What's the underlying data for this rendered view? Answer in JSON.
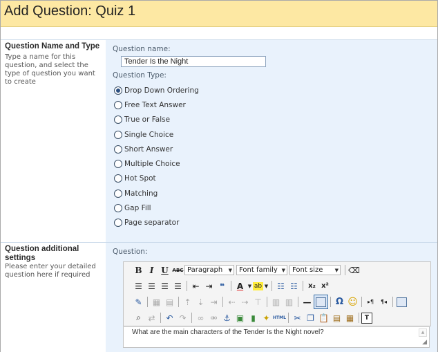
{
  "page": {
    "title": "Add Question: Quiz 1"
  },
  "section_name_type": {
    "title": "Question Name and Type",
    "description": "Type a name for this question, and select the type of question you want to create",
    "name_label": "Question name:",
    "name_value": "Tender Is the Night",
    "type_label": "Question Type:",
    "types": [
      {
        "label": "Drop Down Ordering",
        "checked": true
      },
      {
        "label": "Free Text Answer",
        "checked": false
      },
      {
        "label": "True or False",
        "checked": false
      },
      {
        "label": "Single Choice",
        "checked": false
      },
      {
        "label": "Short Answer",
        "checked": false
      },
      {
        "label": "Multiple Choice",
        "checked": false
      },
      {
        "label": "Hot Spot",
        "checked": false
      },
      {
        "label": "Matching",
        "checked": false
      },
      {
        "label": "Gap Fill",
        "checked": false
      },
      {
        "label": "Page separator",
        "checked": false
      }
    ]
  },
  "section_additional": {
    "title": "Question additional settings",
    "description": "Please enter your detailed question here if required",
    "question_label": "Question:",
    "editor_text": "What are the main characters of the Tender Is the Night novel?"
  },
  "toolbar": {
    "format_select": "Paragraph",
    "font_family_select": "Font family",
    "font_size_select": "Font size",
    "bold": "B",
    "italic": "I",
    "underline": "U",
    "strike": "ABC",
    "html_label": "HTML",
    "subscript": "x₂",
    "superscript": "x²",
    "omega": "Ω",
    "quote": "❝"
  }
}
